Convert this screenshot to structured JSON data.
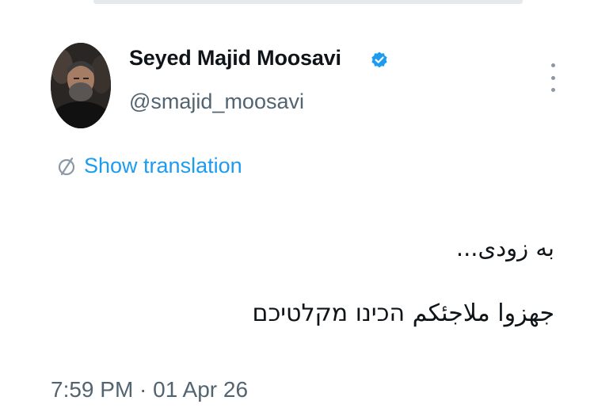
{
  "tweet": {
    "author": {
      "display_name": "Seyed Majid Moosavi",
      "handle": "@smajid_moosavi",
      "verified": true,
      "avatar_icon": "profile-photo"
    },
    "show_translation_label": "Show translation",
    "text_line_1": "به زودی...",
    "text_line_2": "جهزوا ملاجئكم הכינו מקלטיכם",
    "timestamp": "7:59 PM · 01 Apr 26"
  },
  "colors": {
    "link": "#1d9bf0",
    "secondary_text": "#536471",
    "verified_badge": "#1d9bf0",
    "primary_text": "#0f1419"
  },
  "icons": {
    "verified": "verified-badge-icon",
    "translate": "translate-icon",
    "more": "more-options-icon"
  }
}
